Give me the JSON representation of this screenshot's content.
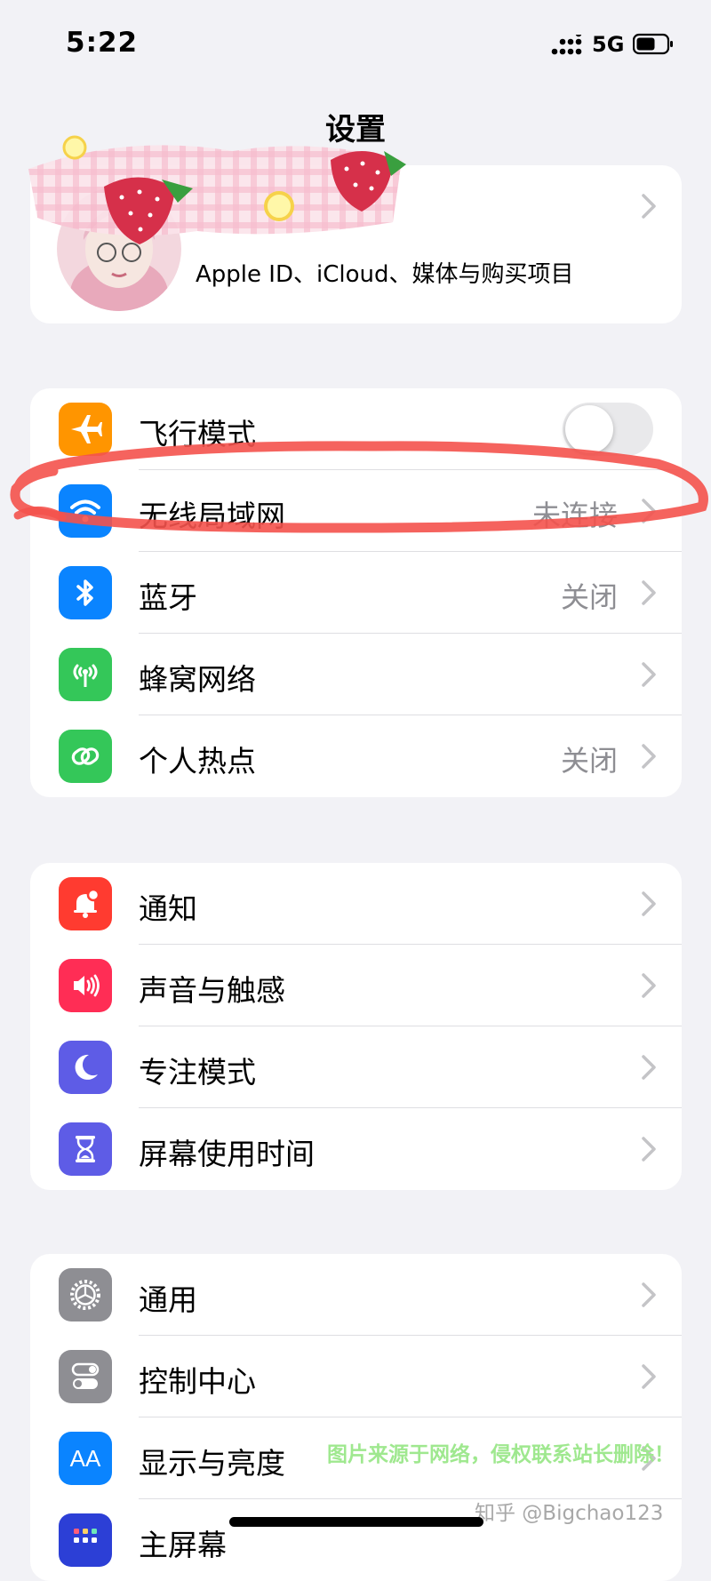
{
  "status_bar": {
    "time": "5:22",
    "network": "5G"
  },
  "page_title": "设置",
  "profile": {
    "subtitle": "Apple ID、iCloud、媒体与购买项目"
  },
  "groups": [
    {
      "items": [
        {
          "label": "飞行模式",
          "icon": "airplane-icon",
          "color": "#ff9500",
          "toggle": false
        },
        {
          "label": "无线局域网",
          "value": "未连接",
          "icon": "wifi-icon",
          "color": "#0a84ff"
        },
        {
          "label": "蓝牙",
          "value": "关闭",
          "icon": "bluetooth-icon",
          "color": "#0a84ff"
        },
        {
          "label": "蜂窝网络",
          "icon": "cellular-icon",
          "color": "#34c759"
        },
        {
          "label": "个人热点",
          "value": "关闭",
          "icon": "hotspot-icon",
          "color": "#34c759"
        }
      ]
    },
    {
      "items": [
        {
          "label": "通知",
          "icon": "notification-icon",
          "color": "#ff3b30"
        },
        {
          "label": "声音与触感",
          "icon": "sound-icon",
          "color": "#ff2d55"
        },
        {
          "label": "专注模式",
          "icon": "moon-icon",
          "color": "#5e5ce6"
        },
        {
          "label": "屏幕使用时间",
          "icon": "hourglass-icon",
          "color": "#5e5ce6"
        }
      ]
    },
    {
      "items": [
        {
          "label": "通用",
          "icon": "gear-icon",
          "color": "#8e8e93"
        },
        {
          "label": "控制中心",
          "icon": "toggles-icon",
          "color": "#8e8e93"
        },
        {
          "label": "显示与亮度",
          "icon": "text-size-icon",
          "color": "#0a84ff",
          "glyph": "AA"
        },
        {
          "label": "主屏幕",
          "icon": "home-screen-icon",
          "color": "#2c3fd6"
        }
      ]
    }
  ],
  "watermark": "图片来源于网络，侵权联系站长删除！",
  "credit": "知乎 @Bigchao123"
}
